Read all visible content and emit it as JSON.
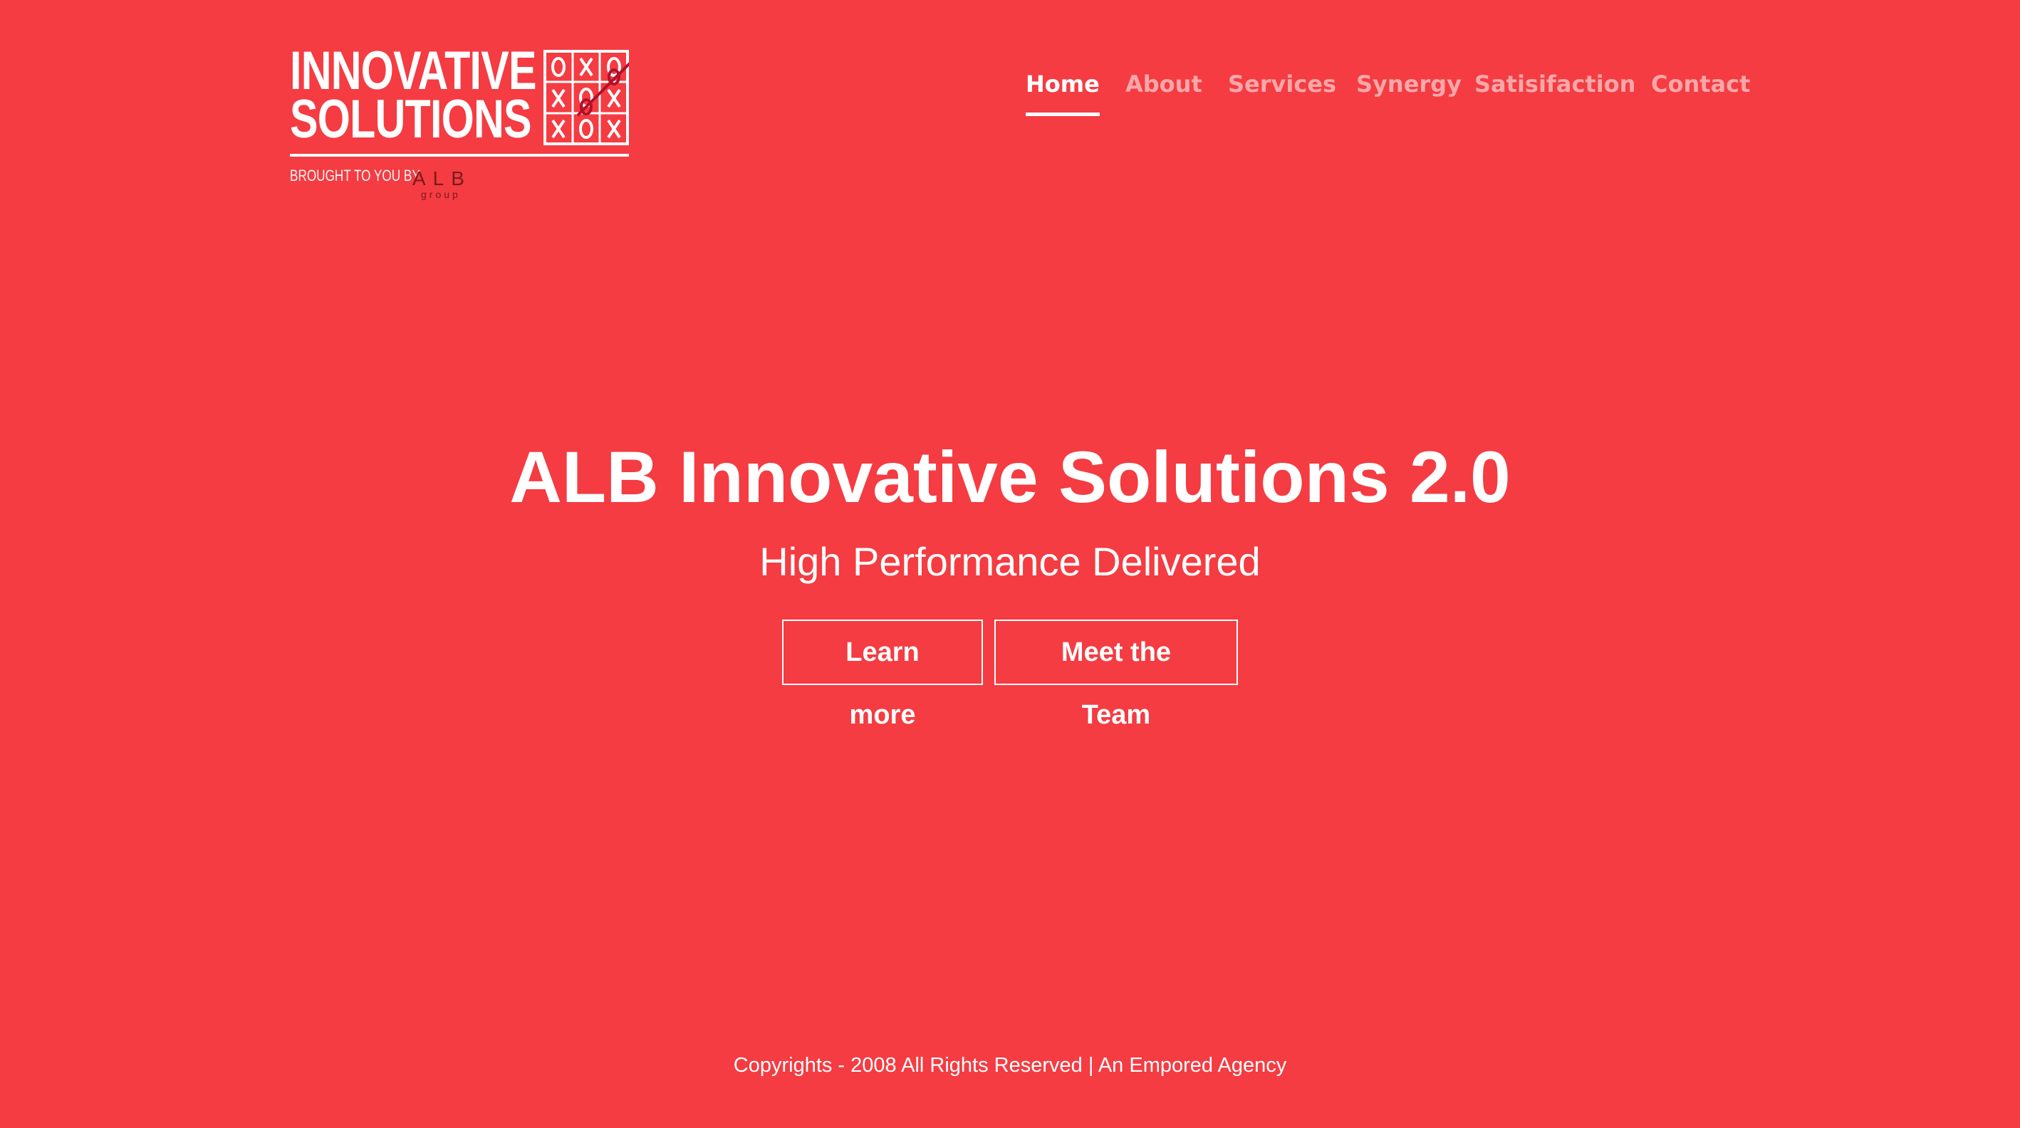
{
  "colors": {
    "background": "#f43c42",
    "text": "#ffffff",
    "nav_inactive": "#fab0b2",
    "logo_accent": "#b3102a"
  },
  "logo": {
    "line1": "INNOVATIVE",
    "line2": "SOLUTIONS",
    "byline": "BROUGHT TO YOU BY",
    "partner_mark": "ALB",
    "partner_sub": "group",
    "icon": "tic-tac-toe-grid-icon"
  },
  "nav": {
    "items": [
      {
        "label": "Home",
        "active": true
      },
      {
        "label": "About",
        "active": false
      },
      {
        "label": "Services",
        "active": false
      },
      {
        "label": "Synergy",
        "active": false
      },
      {
        "label": "Satisifaction",
        "active": false
      },
      {
        "label": "Contact",
        "active": false
      }
    ]
  },
  "hero": {
    "title": "ALB Innovative Solutions 2.0",
    "subtitle": "High Performance Delivered",
    "buttons": {
      "learn_more": "Learn more",
      "meet_team": "Meet the Team"
    }
  },
  "footer": {
    "text": "Copyrights - 2008 All Rights Reserved | An Empored Agency"
  }
}
